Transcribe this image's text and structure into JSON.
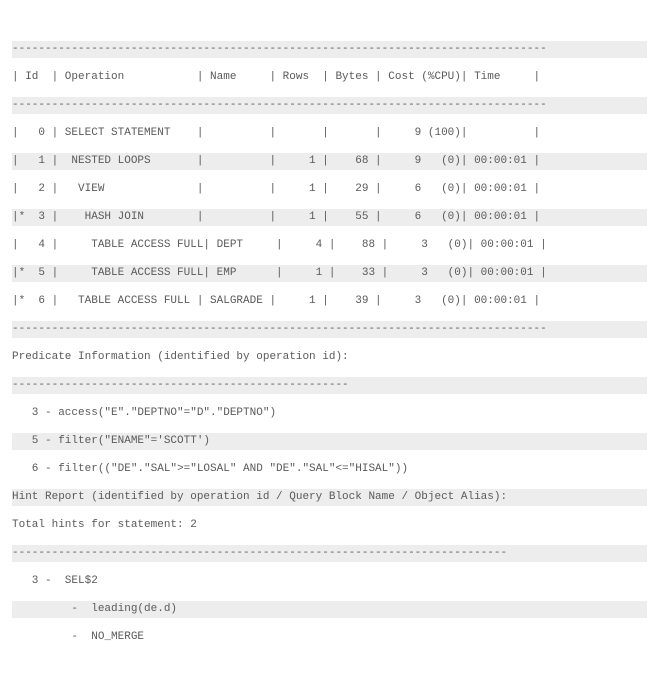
{
  "dash_long": "---------------------------------------------------------------------------------",
  "header": "| Id  | Operation           | Name     | Rows  | Bytes | Cost (%CPU)| Time     |",
  "rows": [
    "|   0 | SELECT STATEMENT    |          |       |       |     9 (100)|          |",
    "|   1 |  NESTED LOOPS       |          |     1 |    68 |     9   (0)| 00:00:01 |",
    "|   2 |   VIEW              |          |     1 |    29 |     6   (0)| 00:00:01 |",
    "|*  3 |    HASH JOIN        |          |     1 |    55 |     6   (0)| 00:00:01 |",
    "|   4 |     TABLE ACCESS FULL| DEPT     |     4 |    88 |     3   (0)| 00:00:01 |",
    "|*  5 |     TABLE ACCESS FULL| EMP      |     1 |    33 |     3   (0)| 00:00:01 |",
    "|*  6 |   TABLE ACCESS FULL | SALGRADE |     1 |    39 |     3   (0)| 00:00:01 |"
  ],
  "pred_title": "Predicate Information (identified by operation id):",
  "dash_mid": "---------------------------------------------------",
  "pred_lines": [
    "   3 - access(\"E\".\"DEPTNO\"=\"D\".\"DEPTNO\")",
    "   5 - filter(\"ENAME\"='SCOTT')",
    "   6 - filter((\"DE\".\"SAL\">=\"LOSAL\" AND \"DE\".\"SAL\"<=\"HISAL\"))"
  ],
  "hint_title": "Hint Report (identified by operation id / Query Block Name / Object Alias):",
  "hint_total": "Total hints for statement: 2",
  "dash_hint": "---------------------------------------------------------------------------",
  "hint_lines": [
    "   3 -  SEL$2",
    "         -  leading(de.d)",
    "         -  NO_MERGE"
  ]
}
